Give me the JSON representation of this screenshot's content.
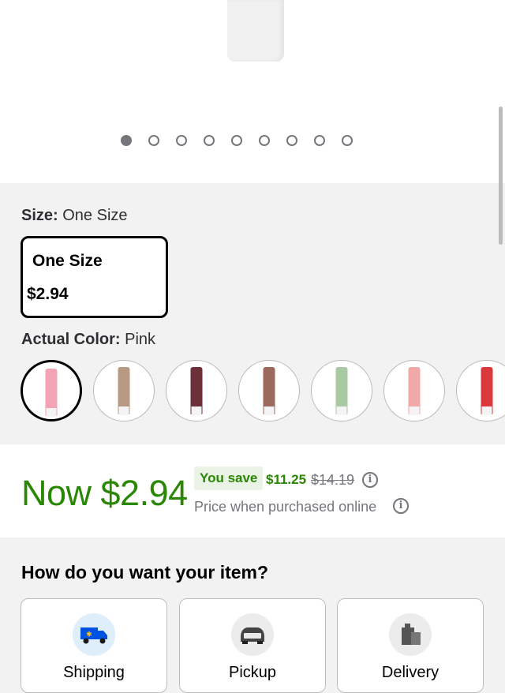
{
  "gallery": {
    "dot_count": 9,
    "active_index": 0
  },
  "size": {
    "label": "Size:",
    "value": "One Size",
    "option_name": "One Size",
    "option_price": "$2.94"
  },
  "color": {
    "label": "Actual Color:",
    "value": "Pink",
    "swatches": [
      {
        "color": "#f2a3b5",
        "selected": true
      },
      {
        "color": "#b89a84",
        "selected": false
      },
      {
        "color": "#6d2f3a",
        "selected": false
      },
      {
        "color": "#9b6a5c",
        "selected": false
      },
      {
        "color": "#a8c9a2",
        "selected": false
      },
      {
        "color": "#f1a9a8",
        "selected": false
      },
      {
        "color": "#d9393d",
        "selected": false
      }
    ]
  },
  "price": {
    "now": "Now $2.94",
    "save_label": "You save",
    "save_amount": "$11.25",
    "was": "$14.19",
    "online_note": "Price when purchased online",
    "info_glyph": "i"
  },
  "fulfillment": {
    "title": "How do you want your item?",
    "options": [
      {
        "label": "Shipping",
        "icon": "shipping-truck-icon"
      },
      {
        "label": "Pickup",
        "icon": "pickup-car-icon"
      },
      {
        "label": "Delivery",
        "icon": "delivery-bag-icon"
      }
    ]
  },
  "colors": {
    "accent_green": "#2a8703",
    "save_bg": "#eaf3e6",
    "muted": "#74767c"
  }
}
